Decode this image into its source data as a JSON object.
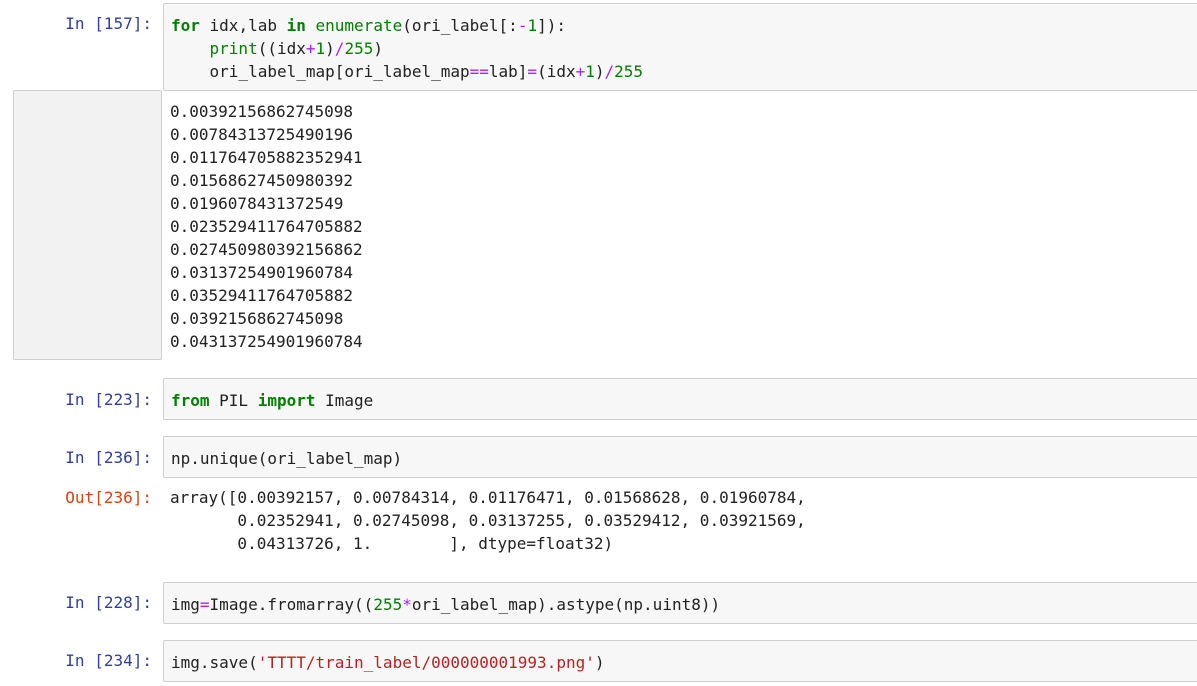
{
  "cells": [
    {
      "prompt": "In [157]:",
      "lines": [
        [
          {
            "t": "for",
            "c": "kw"
          },
          {
            "t": " idx,lab ",
            "c": ""
          },
          {
            "t": "in",
            "c": "kw"
          },
          {
            "t": " ",
            "c": ""
          },
          {
            "t": "enumerate",
            "c": "builtin"
          },
          {
            "t": "(ori_label[:",
            "c": ""
          },
          {
            "t": "-",
            "c": "op"
          },
          {
            "t": "1",
            "c": "num"
          },
          {
            "t": "]):",
            "c": ""
          }
        ],
        [
          {
            "t": "    ",
            "c": ""
          },
          {
            "t": "print",
            "c": "builtin"
          },
          {
            "t": "((idx",
            "c": ""
          },
          {
            "t": "+",
            "c": "op"
          },
          {
            "t": "1",
            "c": "num"
          },
          {
            "t": ")",
            "c": ""
          },
          {
            "t": "/",
            "c": "op"
          },
          {
            "t": "255",
            "c": "num"
          },
          {
            "t": ")",
            "c": ""
          }
        ],
        [
          {
            "t": "    ori_label_map[ori_label_map",
            "c": ""
          },
          {
            "t": "==",
            "c": "op"
          },
          {
            "t": "lab]",
            "c": ""
          },
          {
            "t": "=",
            "c": "op"
          },
          {
            "t": "(idx",
            "c": ""
          },
          {
            "t": "+",
            "c": "op"
          },
          {
            "t": "1",
            "c": "num"
          },
          {
            "t": ")",
            "c": ""
          },
          {
            "t": "/",
            "c": "op"
          },
          {
            "t": "255",
            "c": "num"
          }
        ]
      ],
      "output": [
        "0.00392156862745098",
        "0.00784313725490196",
        "0.011764705882352941",
        "0.01568627450980392",
        "0.0196078431372549",
        "0.023529411764705882",
        "0.027450980392156862",
        "0.03137254901960784",
        "0.03529411764705882",
        "0.0392156862745098",
        "0.043137254901960784"
      ]
    },
    {
      "prompt": "In [223]:",
      "lines": [
        [
          {
            "t": "from",
            "c": "kw"
          },
          {
            "t": " PIL ",
            "c": ""
          },
          {
            "t": "import",
            "c": "kw"
          },
          {
            "t": " Image",
            "c": ""
          }
        ]
      ]
    },
    {
      "prompt": "In [236]:",
      "lines": [
        [
          {
            "t": "np.unique(ori_label_map)",
            "c": ""
          }
        ]
      ],
      "out_prompt": "Out[236]:",
      "output": [
        "array([0.00392157, 0.00784314, 0.01176471, 0.01568628, 0.01960784,",
        "       0.02352941, 0.02745098, 0.03137255, 0.03529412, 0.03921569,",
        "       0.04313726, 1.        ], dtype=float32)"
      ]
    },
    {
      "prompt": "In [228]:",
      "lines": [
        [
          {
            "t": "img",
            "c": ""
          },
          {
            "t": "=",
            "c": "op"
          },
          {
            "t": "Image.fromarray((",
            "c": ""
          },
          {
            "t": "255",
            "c": "num"
          },
          {
            "t": "*",
            "c": "op"
          },
          {
            "t": "ori_label_map).astype(np.uint8))",
            "c": ""
          }
        ]
      ]
    },
    {
      "prompt": "In [234]:",
      "lines": [
        [
          {
            "t": "img.save(",
            "c": ""
          },
          {
            "t": "'TTTT/train_label/000000001993.png'",
            "c": "str"
          },
          {
            "t": ")",
            "c": ""
          }
        ]
      ]
    }
  ]
}
